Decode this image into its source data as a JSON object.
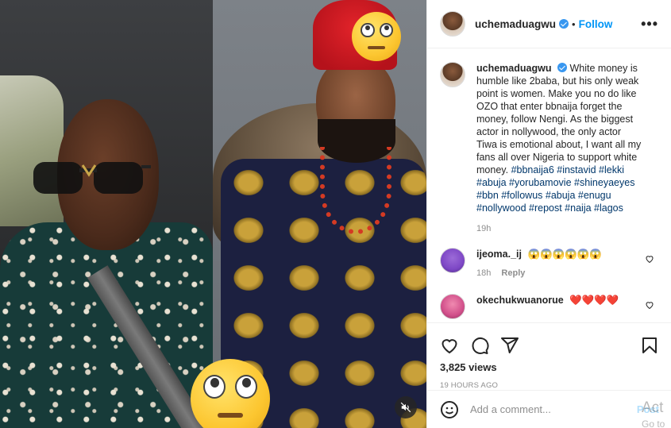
{
  "post": {
    "username": "uchemaduagwu",
    "dot": "•",
    "follow_label": "Follow",
    "more_label": "•••",
    "caption_text": "White money is humble like 2baba, but his only weak point is women. Make you no do like OZO that enter bbnaija forget the money, follow Nengi. As the biggest actor in nollywood, the only actor Tiwa is emotional about, I want all my fans all over Nigeria to support white money.",
    "hashtags": "#bbnaija6 #instavid #lekki #abuja #yorubamovie #shineyaeyes #bbn #followus #abuja #enugu #nollywood #repost #naija #lagos",
    "caption_time": "19h"
  },
  "comments": [
    {
      "username": "ijeoma._ij",
      "text": "😱😱😱😱😱😱",
      "time": "18h",
      "reply_label": "Reply"
    },
    {
      "username": "okechukwuanorue",
      "text": "❤️❤️❤️❤️",
      "time": "",
      "reply_label": ""
    }
  ],
  "stats": {
    "views": "3,825 views",
    "posted_ago": "19 HOURS AGO"
  },
  "composer": {
    "placeholder": "Add a comment...",
    "post_label": "Post"
  },
  "overlay": {
    "activate_line1": "Act",
    "activate_line2": "Go to"
  },
  "colors": {
    "link_blue": "#0095f6",
    "hashtag_blue": "#00376b",
    "muted_gray": "#8e8e8e"
  },
  "icons": [
    "heart-icon",
    "comment-icon",
    "share-icon",
    "save-icon",
    "emoji-icon",
    "mute-icon",
    "verified-icon",
    "more-icon"
  ]
}
